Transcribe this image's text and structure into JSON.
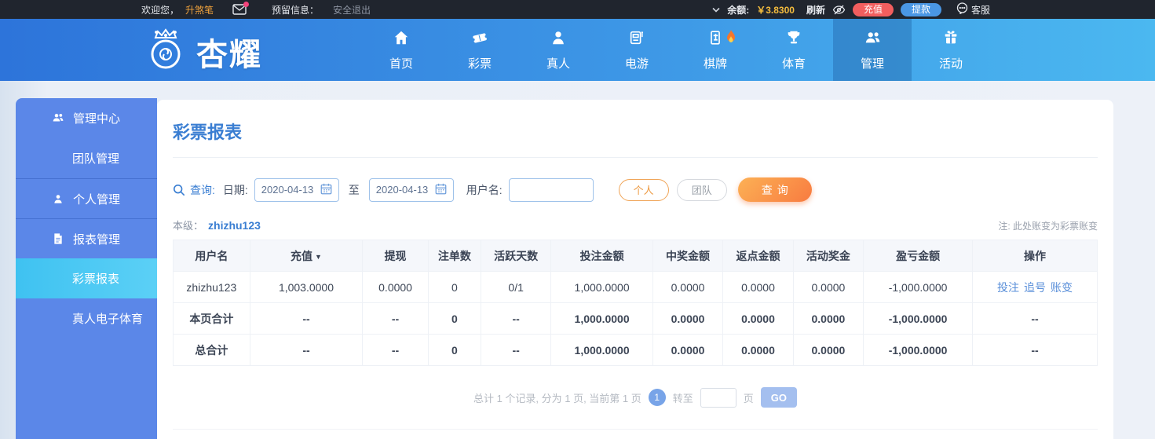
{
  "topbar": {
    "welcome_prefix": "欢迎您，",
    "username": "升煞笔",
    "reserved_label": "预留信息：",
    "logout_label": "安全退出",
    "balance_label": "余额:",
    "balance_value": "￥3.8300",
    "refresh_label": "刷新",
    "recharge_label": "充值",
    "withdraw_label": "提款",
    "service_label": "客服"
  },
  "navbar": {
    "brand": "杏耀",
    "items": [
      {
        "label": "首页",
        "icon": "home-icon"
      },
      {
        "label": "彩票",
        "icon": "ticket-icon"
      },
      {
        "label": "真人",
        "icon": "person-icon"
      },
      {
        "label": "电游",
        "icon": "slot-machine-icon"
      },
      {
        "label": "棋牌",
        "icon": "mahjong-tile-icon",
        "hot": true
      },
      {
        "label": "体育",
        "icon": "trophy-icon"
      },
      {
        "label": "管理",
        "icon": "users-icon",
        "active": true
      },
      {
        "label": "活动",
        "icon": "gift-icon"
      }
    ]
  },
  "sidebar": {
    "items": [
      {
        "label": "管理中心",
        "icon": "users-icon",
        "type": "section"
      },
      {
        "label": "团队管理",
        "type": "child"
      },
      {
        "label": "个人管理",
        "icon": "user-icon",
        "type": "section"
      },
      {
        "label": "报表管理",
        "icon": "report-icon",
        "type": "section"
      },
      {
        "label": "彩票报表",
        "type": "child",
        "active": true
      },
      {
        "label": "真人电子体育",
        "type": "child"
      }
    ]
  },
  "main": {
    "title": "彩票报表",
    "filter": {
      "query_label": "查询:",
      "date_label": "日期:",
      "date_from": "2020-04-13",
      "to_label": "至",
      "date_to": "2020-04-13",
      "username_label": "用户名:",
      "username_value": "",
      "personal_label": "个人",
      "team_label": "团队",
      "search_label": "查询"
    },
    "level_label": "本级：",
    "level_user": "zhizhu123",
    "note": "注: 此处账变为彩票账变",
    "table": {
      "headers": [
        "用户名",
        "充值",
        "提现",
        "注单数",
        "活跃天数",
        "投注金额",
        "中奖金额",
        "返点金额",
        "活动奖金",
        "盈亏金额",
        "操作"
      ],
      "sort_column": "充值",
      "sort_icon": "▼",
      "rows": [
        {
          "cells": [
            "zhizhu123",
            "1,003.0000",
            "0.0000",
            "0",
            "0/1",
            "1,000.0000",
            "0.0000",
            "0.0000",
            "0.0000",
            "-1,000.0000"
          ],
          "ops": [
            "投注",
            "追号",
            "账变"
          ]
        },
        {
          "cells": [
            "本页合计",
            "--",
            "--",
            "0",
            "--",
            "1,000.0000",
            "0.0000",
            "0.0000",
            "0.0000",
            "-1,000.0000"
          ],
          "ops_text": "--",
          "bold": true
        },
        {
          "cells": [
            "总合计",
            "--",
            "--",
            "0",
            "--",
            "1,000.0000",
            "0.0000",
            "0.0000",
            "0.0000",
            "-1,000.0000"
          ],
          "ops_text": "--",
          "bold": true
        }
      ]
    },
    "pagination": {
      "summary": "总计 1 个记录, 分为 1 页, 当前第 1 页",
      "current_page": "1",
      "goto_label": "转至",
      "page_unit": "页",
      "go_label": "GO"
    }
  },
  "colors": {
    "topbar_bg": "#20252e",
    "brand_blue": "#3a7ed2",
    "nav_gradient_start": "#2d74da",
    "nav_gradient_end": "#4bb8f0",
    "sidebar_bg": "#5b87e8",
    "sidebar_active": "#49c5f0",
    "accent_orange": "#f89b4a",
    "recharge_red": "#f25e5e",
    "withdraw_blue": "#4a97e4",
    "negative_red": "#e02b2b",
    "link_blue": "#5a8fd9",
    "balance_yellow": "#f5bd3d"
  }
}
